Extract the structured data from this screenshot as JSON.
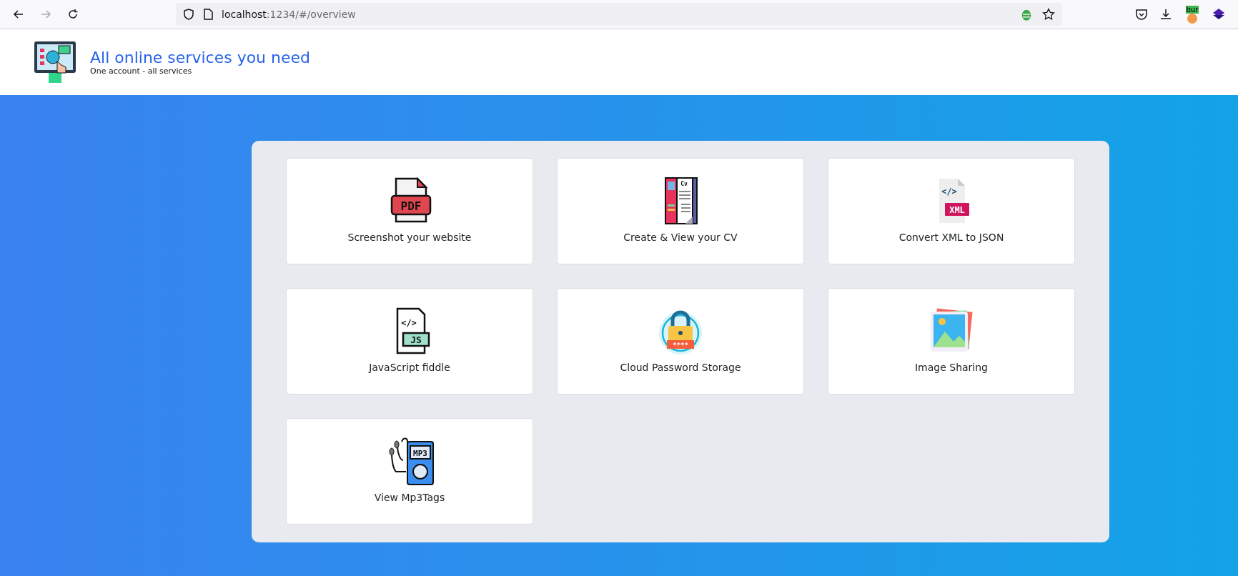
{
  "browser": {
    "address_host": "localhost",
    "address_rest": ":1234/#/overview",
    "extension_badge": "bur"
  },
  "header": {
    "title": "All online services you need",
    "subtitle": "One account - all services"
  },
  "services": [
    {
      "kind": "pdf",
      "label": "Screenshot your website",
      "icon_text": [
        "PDF"
      ]
    },
    {
      "kind": "cv",
      "label": "Create & View your CV",
      "icon_text": [
        "Cv"
      ]
    },
    {
      "kind": "xml",
      "label": "Convert XML to JSON",
      "icon_text": [
        "</>",
        "XML"
      ]
    },
    {
      "kind": "js",
      "label": "JavaScript fiddle",
      "icon_text": [
        "</>",
        "JS"
      ]
    },
    {
      "kind": "lock",
      "label": "Cloud Password Storage",
      "icon_text": [
        "****"
      ]
    },
    {
      "kind": "image",
      "label": "Image Sharing"
    },
    {
      "kind": "mp3",
      "label": "View Mp3Tags",
      "icon_text": [
        "MP3"
      ]
    }
  ]
}
